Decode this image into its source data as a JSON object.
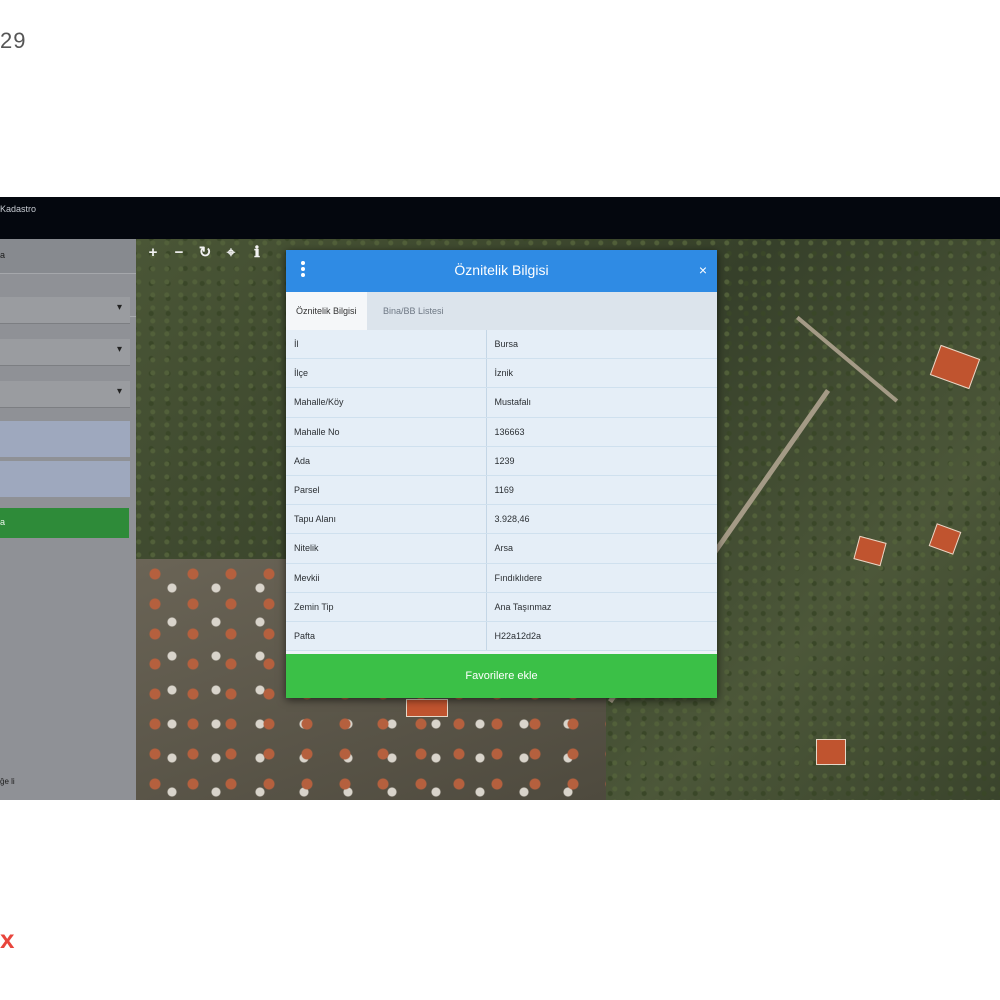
{
  "page_number": "29",
  "app": {
    "title": "Kadastro"
  },
  "sidebar": {
    "header": "a",
    "active_item": "a",
    "footer": "ğe li"
  },
  "dialog": {
    "title": "Öznitelik Bilgisi",
    "close": "×",
    "tabs": [
      {
        "label": "Öznitelik Bilgisi"
      },
      {
        "label": "Bina/BB Listesi"
      }
    ],
    "rows": [
      {
        "label": "İl",
        "value": "Bursa"
      },
      {
        "label": "İlçe",
        "value": "İznik"
      },
      {
        "label": "Mahalle/Köy",
        "value": "Mustafalı"
      },
      {
        "label": "Mahalle No",
        "value": "136663"
      },
      {
        "label": "Ada",
        "value": "1239"
      },
      {
        "label": "Parsel",
        "value": "1169"
      },
      {
        "label": "Tapu Alanı",
        "value": "3.928,46"
      },
      {
        "label": "Nitelik",
        "value": "Arsa"
      },
      {
        "label": "Mevkii",
        "value": "Fındıklıdere"
      },
      {
        "label": "Zemin Tip",
        "value": "Ana Taşınmaz"
      },
      {
        "label": "Pafta",
        "value": "H22a12d2a"
      }
    ],
    "add_favorites_label": "Favorilere ekle"
  },
  "toolbar": {
    "zoom_in": "+",
    "zoom_out": "−",
    "refresh": "↻",
    "locate": "⌖",
    "info": "ℹ"
  },
  "icons": [
    "menu-icon",
    "close-icon",
    "zoom-in-icon",
    "zoom-out-icon",
    "refresh-icon",
    "locate-icon",
    "info-icon",
    "chevron-down-icon"
  ],
  "colors": {
    "header_blue": "#2f8be4",
    "button_green": "#3bc047",
    "sidebar_green": "#2e8b39",
    "bottom_mark": "#e8453c"
  },
  "bottom_mark": "x"
}
